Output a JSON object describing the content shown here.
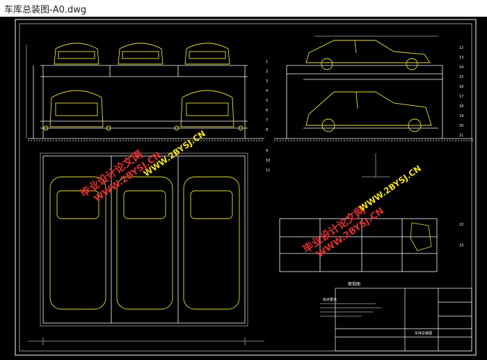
{
  "window": {
    "title": "车库总装图-A0.dwg"
  },
  "colors": {
    "canvas_bg": "#000000",
    "line_white": "#ffffff",
    "line_yellow": "#e8e040",
    "line_cyan": "#40d8e8",
    "watermark_red": "#e03030"
  },
  "watermark": {
    "text_cn": "毕业设计论文网",
    "text_url": "WWW.2BYSJ.CN"
  },
  "drawing": {
    "section_label": "俯视图",
    "note_label": "技术要求",
    "title_block_name": "车库总装图"
  },
  "callouts": [
    "1",
    "2",
    "3",
    "4",
    "5",
    "6",
    "7",
    "8",
    "9",
    "10",
    "11",
    "12",
    "13",
    "14",
    "15",
    "16",
    "17",
    "18",
    "19",
    "20",
    "21",
    "22",
    "23"
  ]
}
